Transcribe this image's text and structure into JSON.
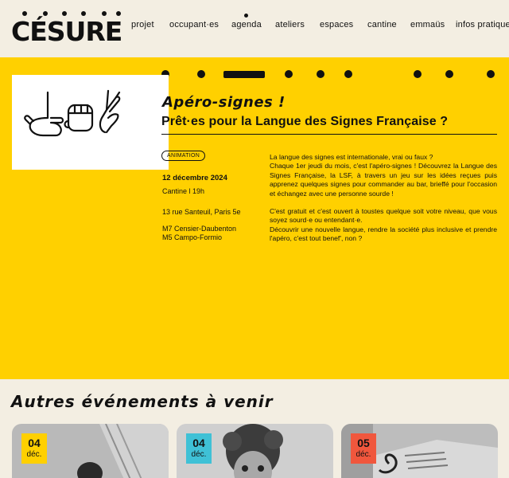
{
  "site": {
    "logo": "CÉSURE"
  },
  "nav": {
    "items": [
      {
        "label": "projet"
      },
      {
        "label": "occupant·es"
      },
      {
        "label": "agenda"
      },
      {
        "label": "ateliers"
      },
      {
        "label": "espaces"
      },
      {
        "label": "cantine"
      },
      {
        "label": "emmaüs"
      },
      {
        "label": "infos pratiques"
      }
    ]
  },
  "event": {
    "title": "Apéro-signes !",
    "subtitle": "Prêt·es pour la Langue des Signes Française ?",
    "category": "ANIMATION",
    "date": "12 décembre 2024",
    "time": "Cantine l 19h",
    "address": "13 rue Santeuil, Paris 5e",
    "metro": [
      "M7 Censier-Daubenton",
      "M5 Campo-Formio"
    ],
    "description": [
      "La langue des signes est internationale, vrai ou faux ?",
      "Chaque 1er jeudi du mois, c'est l'apéro-signes ! Découvrez la Langue des Signes Française, la LSF, à travers un jeu sur les idées reçues puis apprenez quelques signes pour commander au bar, brieffé pour l'occasion et échangez avec une personne sourde !",
      "C'est gratuit et c'est ouvert à toustes quelque soit votre niveau, que vous soyez sourd·e ou entendant·e.",
      "Découvrir une nouvelle langue, rendre la société plus inclusive et prendre l'apéro, c'est tout benef', non ?"
    ]
  },
  "upcoming": {
    "title": "Autres événements à venir",
    "cards": [
      {
        "day": "04",
        "month": "déc.",
        "badge_color": "#ffd000"
      },
      {
        "day": "04",
        "month": "déc.",
        "badge_color": "#3fc1d6"
      },
      {
        "day": "05",
        "month": "déc.",
        "badge_color": "#f0573d"
      }
    ]
  },
  "colors": {
    "accent_yellow": "#ffd000",
    "background": "#f3eee2"
  }
}
